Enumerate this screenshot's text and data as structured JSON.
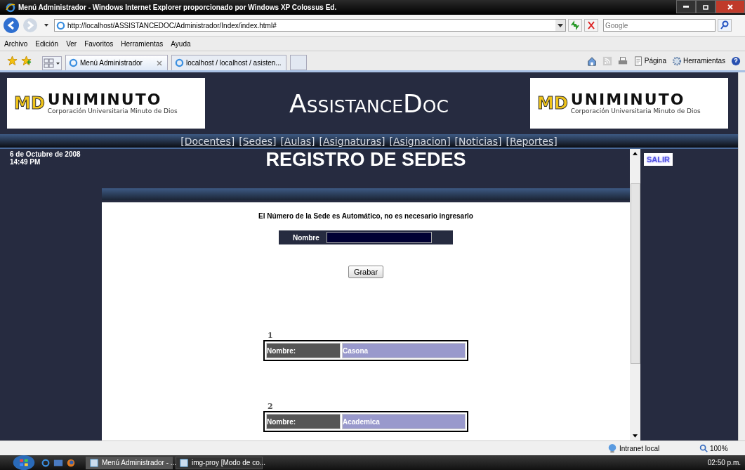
{
  "window": {
    "title": "Menú Administrador - Windows Internet Explorer proporcionado por Windows XP Colossus Ed."
  },
  "address": {
    "url": "http://localhost/ASSISTANCEDOC/Administrador/Index/index.html#"
  },
  "search": {
    "placeholder": "Google"
  },
  "menu": [
    "Archivo",
    "Edición",
    "Ver",
    "Favoritos",
    "Herramientas",
    "Ayuda"
  ],
  "tabs": [
    {
      "label": "Menú Administrador",
      "selected": true
    },
    {
      "label": "localhost / localhost / asisten...",
      "selected": false
    }
  ],
  "command_bar": [
    "Página",
    "Herramientas"
  ],
  "page": {
    "logos": [
      {
        "mark": "MD",
        "name": "UNIMINUTO",
        "subtitle": "Corporación Universitaria Minuto de Dios"
      },
      {
        "mark": "MD",
        "name": "UNIMINUTO",
        "subtitle": "Corporación Universitaria Minuto de Dios"
      }
    ],
    "site_title": "AssistanceDoc",
    "nav": [
      "[Docentes]",
      "[Sedes]",
      "[Aulas]",
      "[Asignaturas]",
      "[Asignacion]",
      "[Noticias]",
      "[Reportes]"
    ],
    "date": "6 de Octubre de 2008",
    "time": "14:49 PM",
    "logout": "SALIR",
    "heading": "REGISTRO DE SEDES",
    "note": "El Número de la Sede es Automático, no es necesario ingresarlo",
    "form": {
      "label": "Nombre",
      "button": "Grabar"
    },
    "records": [
      {
        "number": "1",
        "label": "Nombre:",
        "value": "Casona"
      },
      {
        "number": "2",
        "label": "Nombre:",
        "value": "Academica"
      }
    ]
  },
  "status_bar": {
    "zone": "Intranet local",
    "zoom": "100%"
  },
  "taskbar": {
    "tasks": [
      {
        "label": "Menú Administrador - ...",
        "selected": true
      },
      {
        "label": "img-proy [Modo de co...",
        "selected": false
      }
    ],
    "clock": "02:50 p.m."
  }
}
